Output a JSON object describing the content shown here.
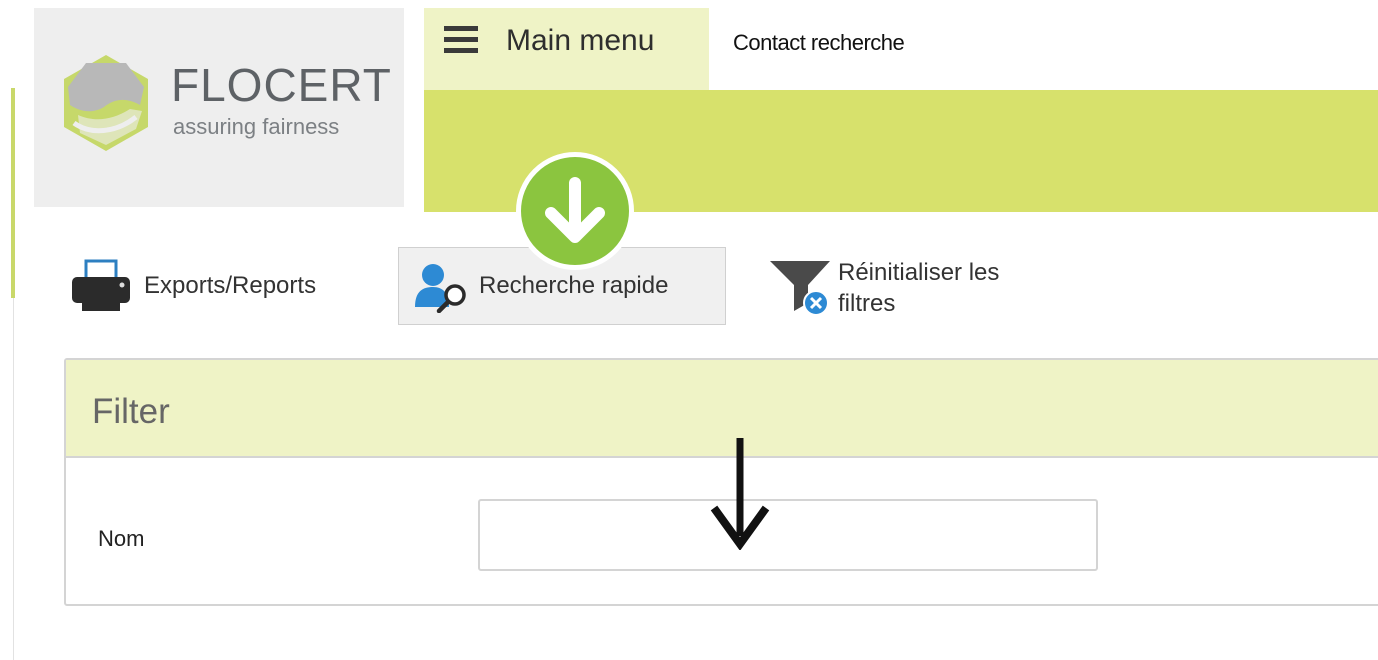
{
  "brand": {
    "name": "FLOCERT",
    "tagline": "assuring fairness",
    "colors": {
      "accent_green": "#d7e16c",
      "pale_green": "#eff3c6",
      "callout_green": "#8bc53f",
      "logo_green": "#c6d86a",
      "logo_gray": "#b8b8b8"
    }
  },
  "nav": {
    "menu_icon": "hamburger-icon",
    "menu_label": "Main menu",
    "contact_link": "Contact recherche"
  },
  "toolbar": {
    "exports": {
      "icon": "printer-icon",
      "label": "Exports/Reports"
    },
    "quick_search": {
      "icon": "user-search-icon",
      "label": "Recherche rapide"
    },
    "reset_filters": {
      "icon": "funnel-clear-icon",
      "label_line1": "Réinitialiser les",
      "label_line2": "filtres"
    }
  },
  "annotations": {
    "callout_icon": "arrow-down-circle-icon",
    "pointer_icon": "arrow-down-icon"
  },
  "filter": {
    "title": "Filter",
    "fields": [
      {
        "label": "Nom",
        "value": "",
        "placeholder": ""
      }
    ]
  }
}
